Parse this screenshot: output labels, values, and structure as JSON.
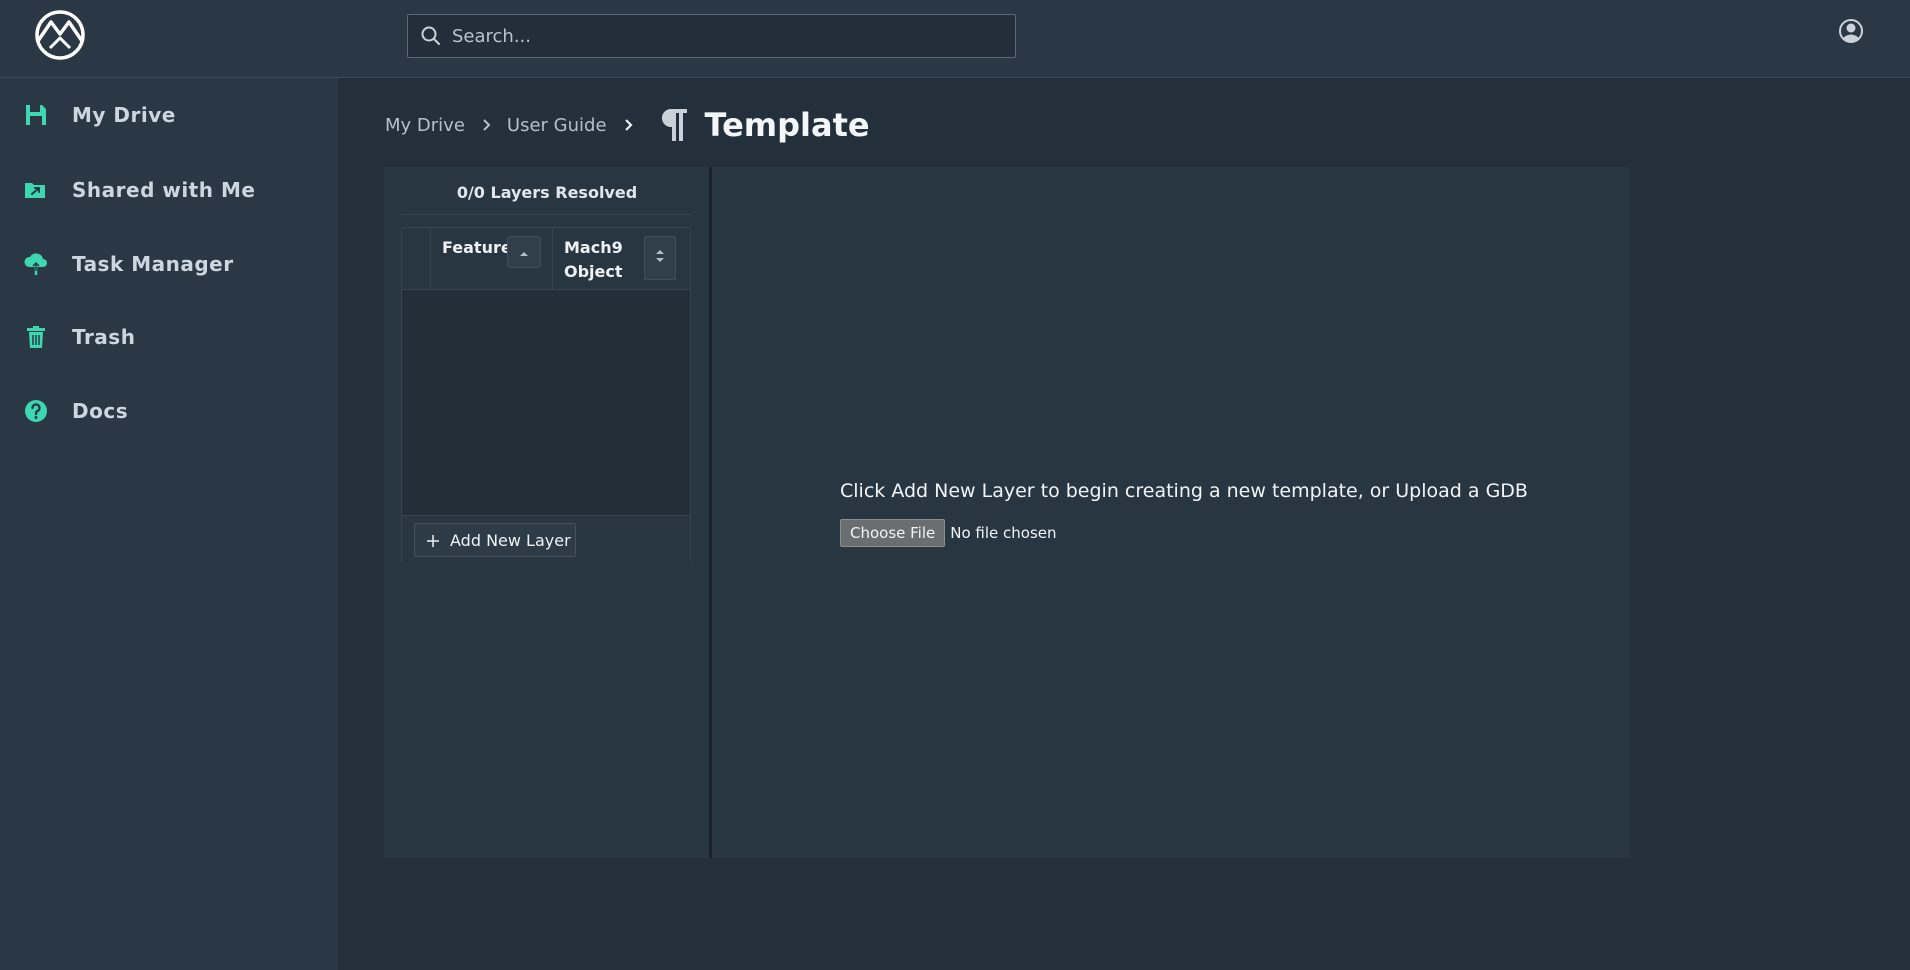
{
  "header": {
    "logo_icon": "mountain-logo-icon",
    "search": {
      "placeholder": "Search...",
      "value": ""
    },
    "user_icon": "user-account-icon"
  },
  "sidebar": {
    "accent_color": "#3dd8b0",
    "items": [
      {
        "label": "My Drive",
        "icon": "save-disk-icon"
      },
      {
        "label": "Shared with Me",
        "icon": "shared-folder-icon"
      },
      {
        "label": "Task Manager",
        "icon": "cloud-upload-icon"
      },
      {
        "label": "Trash",
        "icon": "trash-icon"
      },
      {
        "label": "Docs",
        "icon": "help-circle-icon"
      }
    ]
  },
  "breadcrumb": {
    "items": [
      "My Drive",
      "User Guide"
    ],
    "current": "Template",
    "title_icon": "pilcrow-icon"
  },
  "layers_panel": {
    "resolved_text": "0/0 Layers Resolved",
    "columns": [
      {
        "label": "Feature",
        "sort": "ascending"
      },
      {
        "label": "Mach9 Object",
        "sort": "none"
      }
    ],
    "rows": [],
    "add_button_label": "Add New Layer"
  },
  "editor": {
    "empty_message": "Click Add New Layer to begin creating a new template, or Upload a GDB",
    "choose_file_label": "Choose File",
    "file_status": "No file chosen"
  }
}
